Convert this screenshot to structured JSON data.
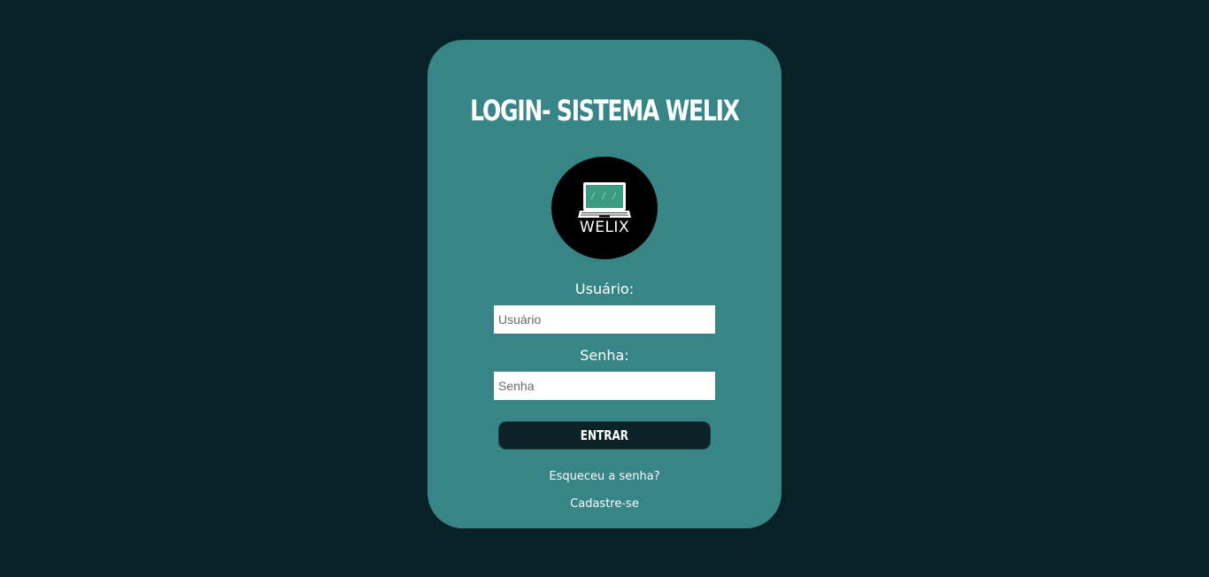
{
  "login": {
    "title": "LOGIN- SISTEMA WELIX",
    "logo_icon": "laptop-icon",
    "logo_text": "WELIX",
    "username_label": "Usuário:",
    "username_placeholder": "Usuário",
    "username_value": "",
    "password_label": "Senha:",
    "password_placeholder": "Senha",
    "password_value": "",
    "submit_label": "ENTRAR",
    "forgot_link": "Esqueceu a senha?",
    "register_link": "Cadastre-se"
  },
  "colors": {
    "background": "#082126",
    "card": "#388588",
    "button": "#0b2226",
    "text": "#ffffff"
  }
}
